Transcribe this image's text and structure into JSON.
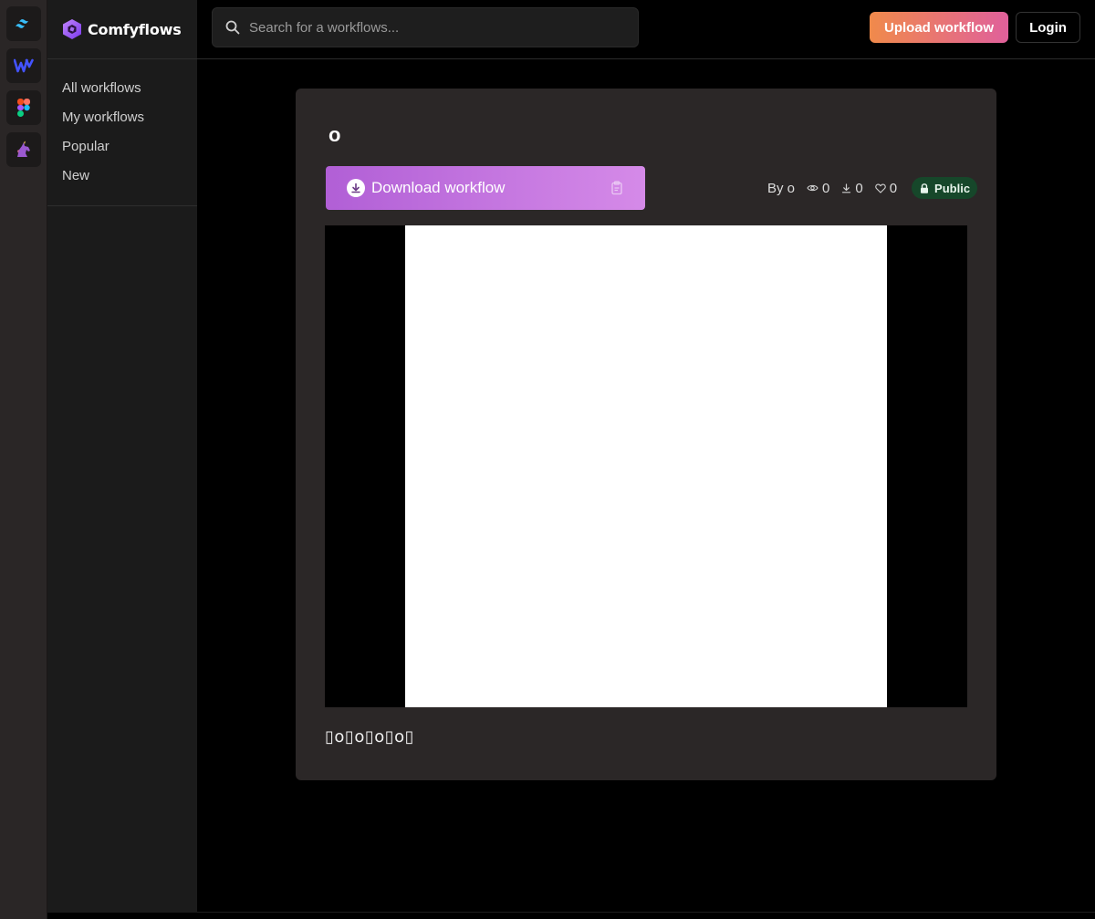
{
  "brand": {
    "name": "Comfyflows"
  },
  "rail": {
    "apps": [
      "tailwind-icon",
      "webflow-icon",
      "figma-icon",
      "unicorn-icon"
    ]
  },
  "sidebar": {
    "items": [
      {
        "label": "All workflows"
      },
      {
        "label": "My workflows"
      },
      {
        "label": "Popular"
      },
      {
        "label": "New"
      }
    ]
  },
  "header": {
    "search_placeholder": "Search for a workflows...",
    "upload_label": "Upload workflow",
    "login_label": "Login"
  },
  "workflow": {
    "title": "o",
    "download_label": "Download workflow",
    "author": "By o",
    "views": "0",
    "downloads": "0",
    "likes": "0",
    "visibility": "Public",
    "description": "▯o▯o▯o▯o▯"
  },
  "colors": {
    "upload_gradient": [
      "#f08a4b",
      "#e0609b"
    ],
    "download_gradient": [
      "#b15fd6",
      "#d58ae8"
    ],
    "public_badge": "#16472a",
    "card_bg": "#2b2727"
  }
}
